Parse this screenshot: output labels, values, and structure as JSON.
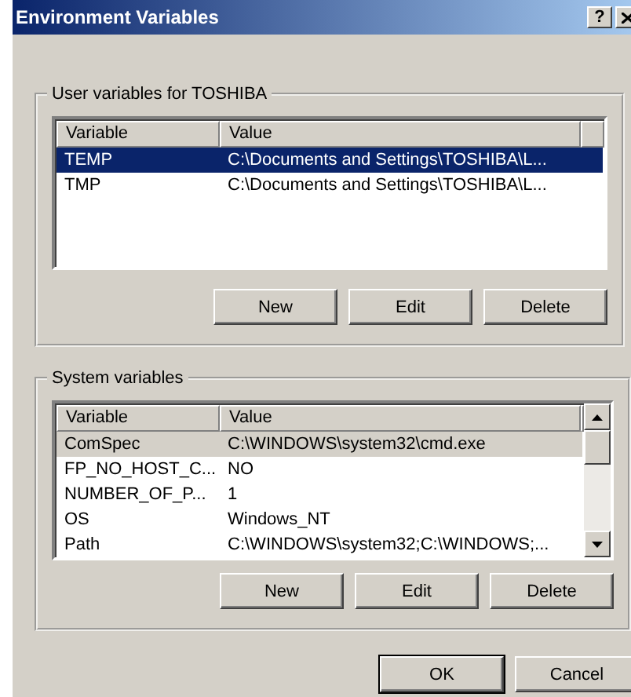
{
  "window": {
    "title": "Environment Variables",
    "help": "?"
  },
  "groups": [
    {
      "title": "User variables for TOSHIBA",
      "focused": true,
      "scrollbar": false,
      "columns": [
        "Variable",
        "Value"
      ],
      "rows": [
        {
          "variable": "TEMP",
          "value": "C:\\Documents and Settings\\TOSHIBA\\L...",
          "selected": true
        },
        {
          "variable": "TMP",
          "value": "C:\\Documents and Settings\\TOSHIBA\\L...",
          "selected": false
        }
      ],
      "buttons": [
        "New",
        "Edit",
        "Delete"
      ]
    },
    {
      "title": "System variables",
      "focused": false,
      "scrollbar": true,
      "columns": [
        "Variable",
        "Value"
      ],
      "rows": [
        {
          "variable": "ComSpec",
          "value": "C:\\WINDOWS\\system32\\cmd.exe",
          "selected": true
        },
        {
          "variable": "FP_NO_HOST_C...",
          "value": "NO",
          "selected": false
        },
        {
          "variable": "NUMBER_OF_P...",
          "value": "1",
          "selected": false
        },
        {
          "variable": "OS",
          "value": "Windows_NT",
          "selected": false
        },
        {
          "variable": "Path",
          "value": "C:\\WINDOWS\\system32;C:\\WINDOWS;...",
          "selected": false
        }
      ],
      "buttons": [
        "New",
        "Edit",
        "Delete"
      ]
    }
  ],
  "buttons": [
    "OK",
    "Cancel"
  ]
}
